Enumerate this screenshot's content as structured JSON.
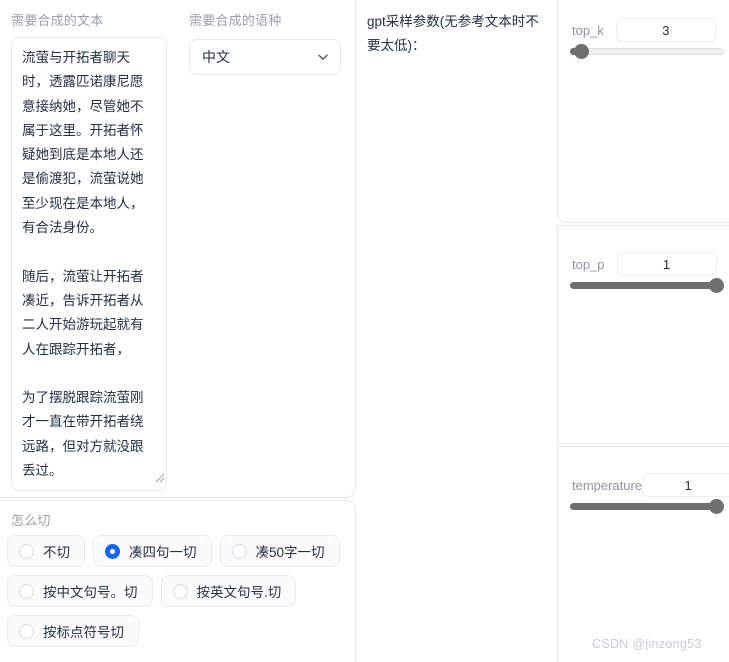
{
  "left": {
    "text_section": {
      "label": "需要合成的文本",
      "textarea_value": "流萤与开拓者聊天时，透露匹诺康尼愿意接纳她，尽管她不属于这里。开拓者怀疑她到底是本地人还是偷渡犯，流萤说她至少现在是本地人，有合法身份。\n\n随后，流萤让开拓者凑近，告诉开拓者从二人开始游玩起就有人在跟踪开拓者，\n\n为了摆脱跟踪流萤刚才一直在带开拓者绕远路，但对方就没跟丢过。\n\n流萤详细描述了跟踪者的具体特征，包括身高、体型、步法",
      "resize_grip_icon": "resize-grip-icon"
    },
    "language_section": {
      "label": "需要合成的语种",
      "selected": "中文",
      "chevron_icon": "chevron-down-icon"
    },
    "slice_section": {
      "label": "怎么切",
      "options": [
        {
          "label": "不切",
          "selected": false
        },
        {
          "label": "凑四句一切",
          "selected": true
        },
        {
          "label": "凑50字一切",
          "selected": false
        },
        {
          "label": "按中文句号。切",
          "selected": false
        },
        {
          "label": "按英文句号.切",
          "selected": false
        },
        {
          "label": "按标点符号切",
          "selected": false
        }
      ]
    }
  },
  "middle": {
    "note": "gpt采样参数(无参考文本时不要太低)："
  },
  "right": {
    "sliders": [
      {
        "name": "top_k",
        "value": "3",
        "fill_percent": 3
      },
      {
        "name": "top_p",
        "value": "1",
        "fill_percent": 100
      },
      {
        "name": "temperature",
        "value": "1",
        "fill_percent": 100
      }
    ]
  },
  "watermark": "CSDN @jinzong53",
  "colors": {
    "accent": "#1666f0",
    "slider": "#6f6f6f",
    "label": "#9aa0ab",
    "text": "#253043",
    "border": "#e5e7eb"
  }
}
